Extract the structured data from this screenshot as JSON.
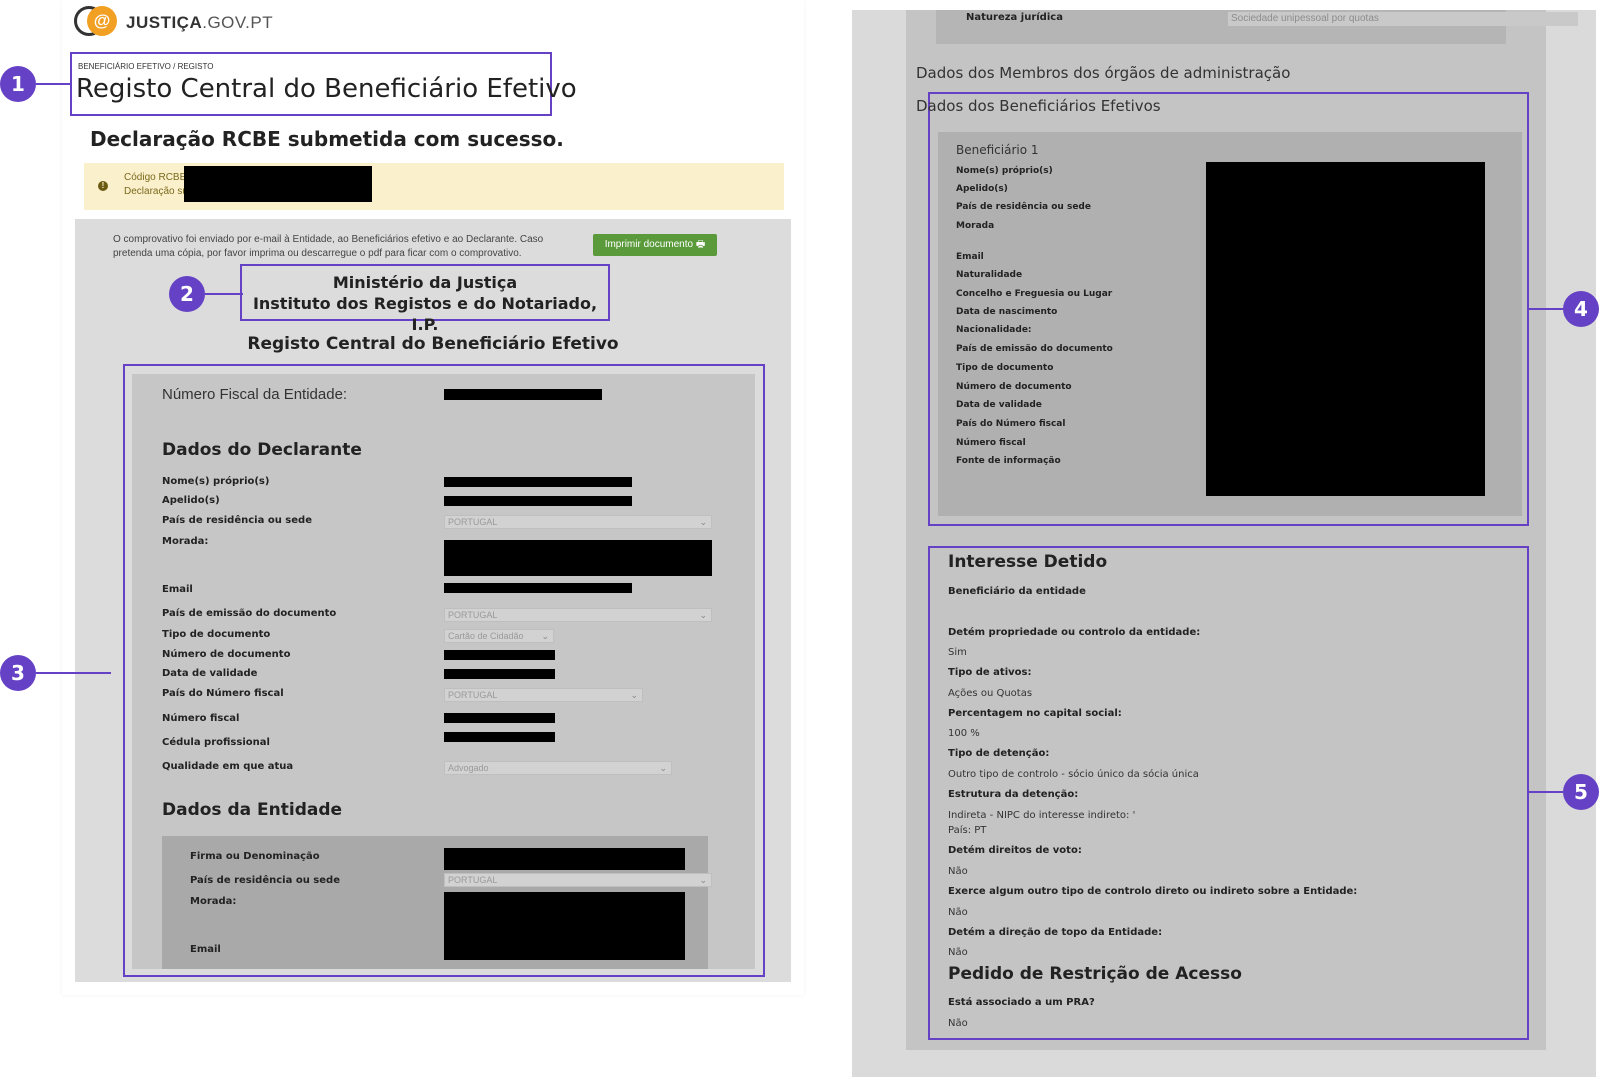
{
  "left": {
    "logo": {
      "bold": "JUSTIÇA",
      "rest": ".GOV.PT",
      "colors": {
        "orange": "#f2a024",
        "outline": "#333333"
      }
    },
    "breadcrumb": "BENEFICIÁRIO EFETIVO / REGISTO",
    "title": "Registo Central do Beneficiário Efetivo",
    "success": "Declaração RCBE submetida com sucesso.",
    "alert": {
      "icon": "exclamation-icon",
      "line1": "Código RCBE:",
      "line2": "Declaração su"
    },
    "info_line1": "O comprovativo foi enviado por e-mail à Entidade, ao Beneficiários efetivo e ao Declarante. Caso",
    "info_line2": "pretenda uma cópia, por favor imprima ou descarregue o pdf para ficar com o comprovativo.",
    "print_button": "Imprimir documento",
    "ministry_line1": "Ministério da Justiça",
    "ministry_line2": "Instituto dos Registos e do Notariado, I.P.",
    "subtitle": "Registo Central do Beneficiário Efetivo",
    "nif_label": "Número Fiscal da Entidade:",
    "declarante": {
      "heading": "Dados do Declarante",
      "labels": {
        "nomes": "Nome(s) próprio(s)",
        "apelidos": "Apelido(s)",
        "pais_residencia": "País de residência ou sede",
        "morada": "Morada:",
        "email": "Email",
        "pais_emissao": "País de emissão do documento",
        "tipo_doc": "Tipo de documento",
        "num_doc": "Número de documento",
        "validade": "Data de validade",
        "pais_nif": "País do Número fiscal",
        "nif": "Número fiscal",
        "cedula": "Cédula profissional",
        "qualidade": "Qualidade em que atua"
      },
      "values": {
        "pais_residencia": "PORTUGAL",
        "pais_emissao": "PORTUGAL",
        "tipo_doc": "Cartão de Cidadão",
        "pais_nif": "PORTUGAL",
        "qualidade": "Advogado"
      }
    },
    "entidade": {
      "heading": "Dados da Entidade",
      "labels": {
        "firma": "Firma ou Denominação",
        "pais": "País de residência ou sede",
        "morada": "Morada:",
        "email": "Email"
      },
      "values": {
        "pais": "PORTUGAL"
      }
    }
  },
  "right": {
    "natureza_label": "Natureza jurídica",
    "natureza_value": "Sociedade unipessoal por quotas",
    "membros_heading": "Dados dos Membros dos órgãos de administração",
    "beneficiarios_heading": "Dados dos Beneficiários Efetivos",
    "beneficiario_title": "Beneficiário 1",
    "ben_labels": [
      "Nome(s) próprio(s)",
      "Apelido(s)",
      "País de residência ou sede",
      "Morada",
      "Email",
      "Naturalidade",
      "Concelho e Freguesia ou Lugar",
      "Data de nascimento",
      "Nacionalidade:",
      "País de emissão do documento",
      "Tipo de documento",
      "Número de documento",
      "Data de validade",
      "País do Número fiscal",
      "Número fiscal",
      "Fonte de informação"
    ],
    "interesse": {
      "heading": "Interesse Detido",
      "sub": "Beneficiário da entidade",
      "q1": "Detém propriedade ou controlo da entidade:",
      "a1": "Sim",
      "q2": "Tipo de ativos:",
      "a2": "Ações ou Quotas",
      "q3": "Percentagem no capital social:",
      "a3": "100 %",
      "q4": "Tipo de detenção:",
      "a4": "Outro tipo de controlo - sócio único da sócia única",
      "q5": "Estrutura da detenção:",
      "a5a": "Indireta - NIPC do interesse indireto: '",
      "a5b": "País: PT",
      "q6": "Detém direitos de voto:",
      "a6": "Não",
      "q7": "Exerce algum outro tipo de controlo direto ou indireto sobre a Entidade:",
      "a7": "Não",
      "q8": "Detém a direção de topo da Entidade:",
      "a8": "Não"
    },
    "restricao": {
      "heading": "Pedido de Restrição de Acesso",
      "q": "Está associado a um PRA?",
      "a": "Não"
    }
  },
  "callouts": [
    "1",
    "2",
    "3",
    "4",
    "5"
  ],
  "accent": "#6441c5"
}
